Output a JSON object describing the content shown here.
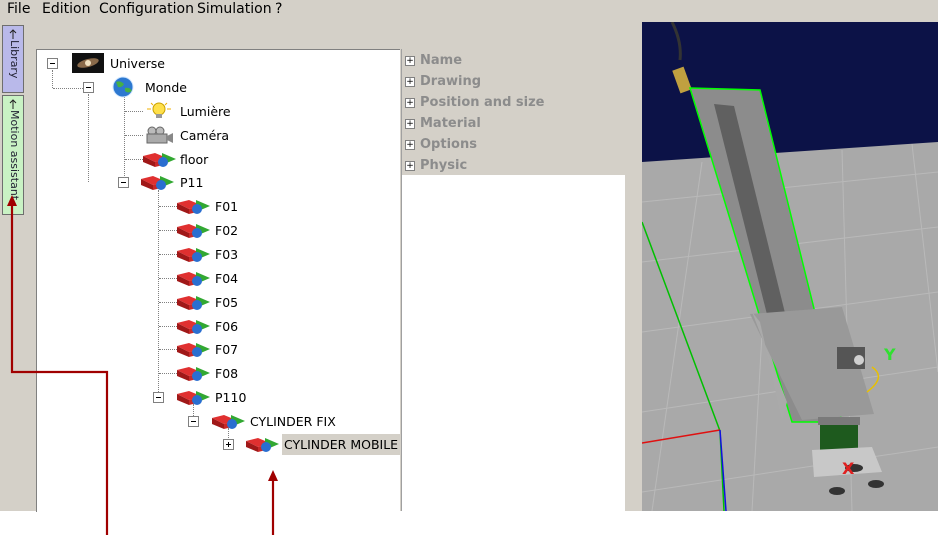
{
  "menu": [
    "File",
    "Edition",
    "Configuration",
    "Simulation",
    "?"
  ],
  "side_tabs": {
    "library": "Library",
    "motion": "Motion assistant"
  },
  "tree": {
    "universe": "Universe",
    "monde": "Monde",
    "lumiere": "Lumière",
    "camera": "Caméra",
    "floor": "floor",
    "p11": "P11",
    "f_items": [
      "F01",
      "F02",
      "F03",
      "F04",
      "F05",
      "F06",
      "F07",
      "F08"
    ],
    "p110": "P110",
    "cyl_fix": "CYLINDER FIX",
    "cyl_mobile": "CYLINDER MOBILE"
  },
  "properties": [
    "Name",
    "Drawing",
    "Position and size",
    "Material",
    "Options",
    "Physic"
  ],
  "viewport": {
    "axis_y": "Y",
    "axis_x": "X"
  },
  "colors": {
    "annotation_arrow": "#a00000",
    "selection_outline": "#00ff00",
    "viewport_bg": "#0c1247"
  }
}
